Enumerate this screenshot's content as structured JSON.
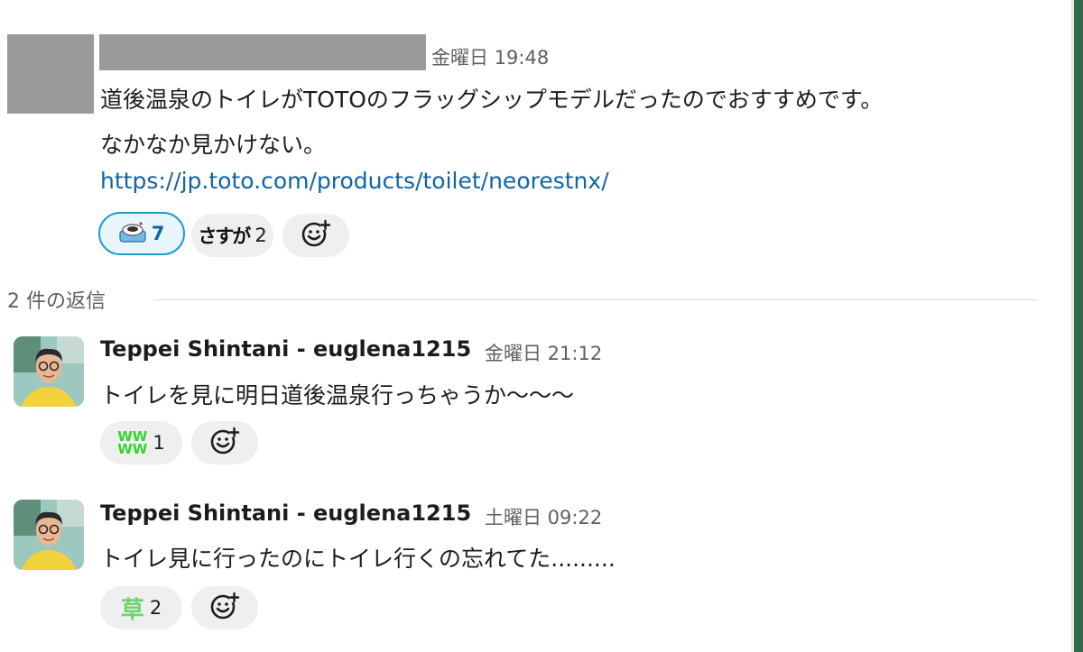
{
  "thread": {
    "parent": {
      "timestamp": "金曜日 19:48",
      "text_line1": "道後温泉のトイレがTOTOのフラッグシップモデルだったのでおすすめです。",
      "text_line2": "なかなか見かけない。",
      "link": "https://jp.toto.com/products/toilet/neorestnx/",
      "reactions": [
        {
          "emoji": "toilet-icon",
          "count": "7",
          "active": true
        },
        {
          "emoji_text": "さすが",
          "count": "2",
          "active": false
        }
      ]
    },
    "replies_label": "2 件の返信",
    "replies": [
      {
        "user": "Teppei Shintani - euglena1215",
        "timestamp": "金曜日 21:12",
        "text": "トイレを見に明日道後温泉行っちゃうか〜〜〜",
        "reactions": [
          {
            "emoji_text": "WW\nWW",
            "count": "1"
          }
        ]
      },
      {
        "user": "Teppei Shintani - euglena1215",
        "timestamp": "土曜日 09:22",
        "text": "トイレ見に行ったのにトイレ行くの忘れてた.........",
        "reactions": [
          {
            "emoji_text": "草",
            "count": "2"
          }
        ]
      }
    ]
  },
  "colors": {
    "link": "#1264a3",
    "active_reaction_border": "#1d9bd1",
    "reaction_bg": "#efefef",
    "right_edge": "#2f6b4f"
  },
  "icons": {
    "add_reaction": "add-reaction-icon",
    "avatar": "avatar"
  }
}
